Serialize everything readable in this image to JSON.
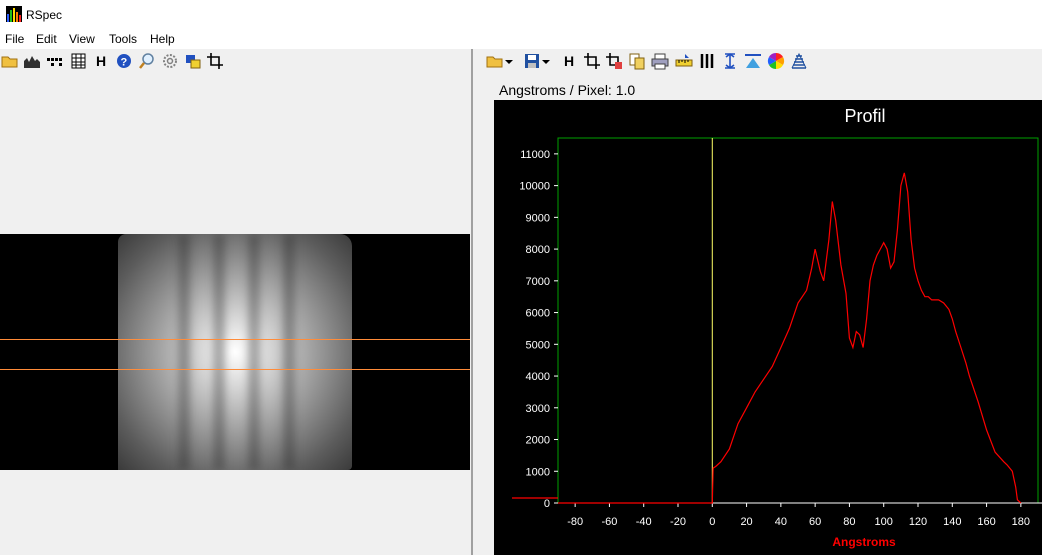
{
  "window": {
    "title": "RSpec"
  },
  "menu": [
    "File",
    "Edit",
    "View",
    "Tools",
    "Help"
  ],
  "left_toolbar_icons": [
    "open-folder-icon",
    "histogram-icon",
    "dotted-lines-icon",
    "grid-icon",
    "h-icon",
    "help-icon",
    "zoom-icon",
    "settings-icon",
    "overlay-icon",
    "crop-icon"
  ],
  "right_toolbar_icons": [
    "open-folder-icon",
    "dropdown-arrow-icon",
    "save-icon",
    "dropdown-arrow-icon",
    "h-icon",
    "crop-icon",
    "crop-add-icon",
    "copy-icon",
    "print-icon",
    "ruler-icon",
    "lines-icon",
    "vertical-arrows-icon",
    "triangle-icon",
    "color-wheel-icon",
    "layers-icon"
  ],
  "calibration": {
    "label": "Angstroms / Pixel: 1.0"
  },
  "colors": {
    "curve": "#ff0000",
    "frame": "#00a000",
    "marker": "#ffff66",
    "xlabel": "#ff0000",
    "selection_lines": "#ff8c3a"
  },
  "chart_data": {
    "type": "line",
    "title": "Profil",
    "xlabel": "Angstroms",
    "ylabel": "",
    "xlim": [
      -90,
      190
    ],
    "ylim": [
      0,
      11500
    ],
    "xticks": [
      -80,
      -60,
      -40,
      -20,
      0,
      20,
      40,
      60,
      80,
      100,
      120,
      140,
      160,
      180
    ],
    "yticks": [
      0,
      1000,
      2000,
      3000,
      4000,
      5000,
      6000,
      7000,
      8000,
      9000,
      10000,
      11000
    ],
    "marker_x": 0,
    "series": [
      {
        "name": "",
        "x": [
          -90,
          0,
          0.5,
          2,
          5,
          10,
          15,
          20,
          25,
          30,
          35,
          40,
          45,
          50,
          55,
          58,
          60,
          63,
          65,
          68,
          70,
          72,
          75,
          78,
          80,
          82,
          84,
          86,
          88,
          90,
          92,
          94,
          96,
          98,
          100,
          102,
          104,
          106,
          108,
          110,
          112,
          114,
          116,
          118,
          120,
          122,
          124,
          126,
          128,
          130,
          132,
          135,
          138,
          140,
          142,
          145,
          148,
          150,
          155,
          160,
          165,
          170,
          172,
          175,
          177,
          178,
          180
        ],
        "y": [
          0,
          0,
          1100,
          1150,
          1300,
          1700,
          2500,
          3000,
          3500,
          3900,
          4300,
          4900,
          5500,
          6300,
          6700,
          7400,
          8000,
          7300,
          7000,
          8300,
          9500,
          8900,
          7500,
          6600,
          5200,
          4900,
          5400,
          5300,
          4900,
          5800,
          7000,
          7500,
          7800,
          8000,
          8200,
          8000,
          7400,
          7600,
          8600,
          10000,
          10400,
          9800,
          8300,
          7400,
          7000,
          6700,
          6500,
          6500,
          6400,
          6400,
          6400,
          6300,
          6100,
          5800,
          5400,
          4900,
          4400,
          4000,
          3200,
          2300,
          1600,
          1300,
          1200,
          1000,
          500,
          100,
          0
        ]
      }
    ]
  }
}
